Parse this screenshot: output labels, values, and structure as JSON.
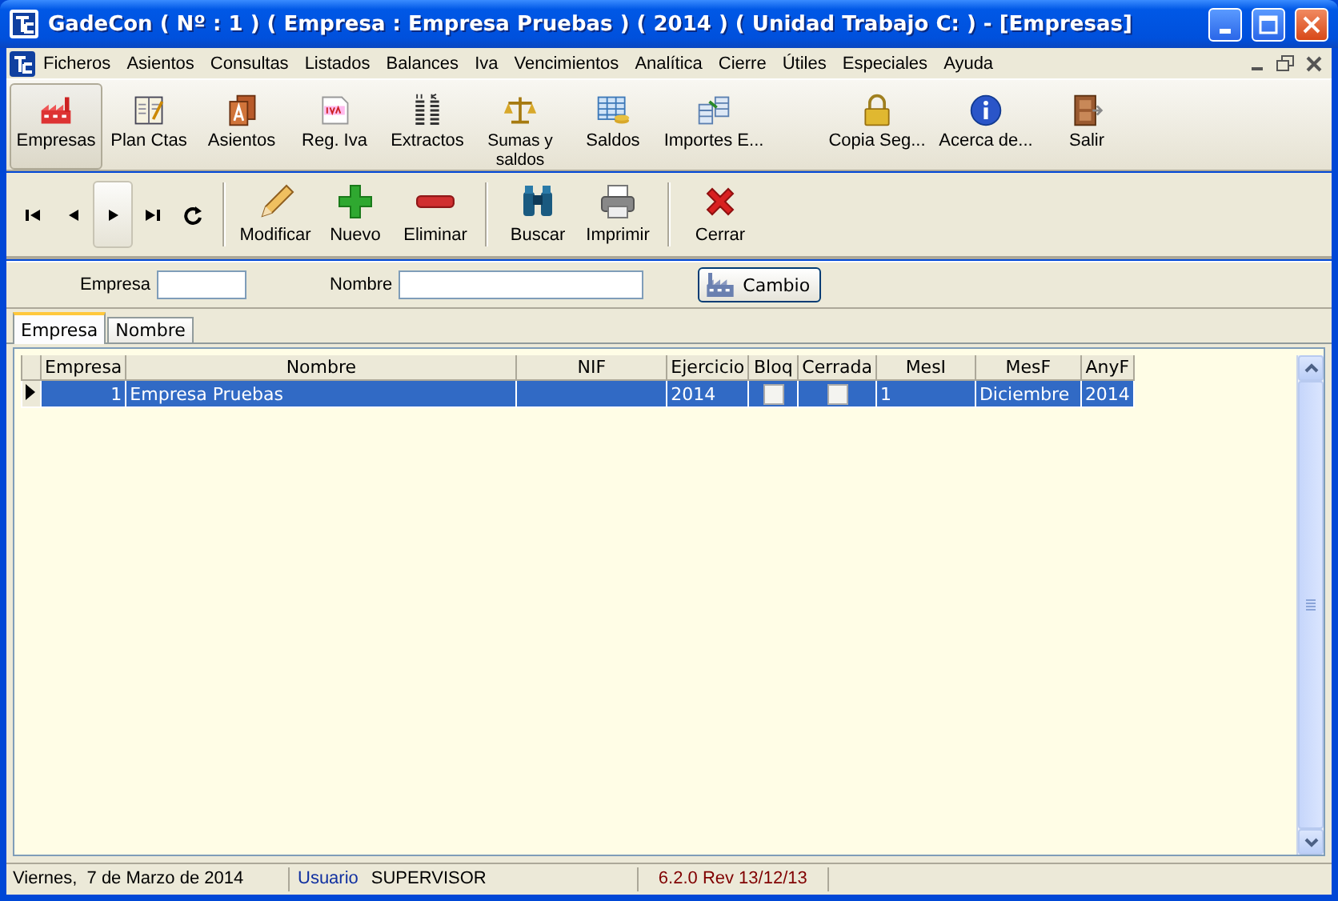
{
  "window": {
    "title": "GadeCon ( Nº : 1 ) ( Empresa : Empresa Pruebas ) ( 2014 ) ( Unidad Trabajo C: ) - [Empresas]"
  },
  "menu": [
    "Ficheros",
    "Asientos",
    "Consultas",
    "Listados",
    "Balances",
    "Iva",
    "Vencimientos",
    "Analítica",
    "Cierre",
    "Útiles",
    "Especiales",
    "Ayuda"
  ],
  "main_toolbar": [
    {
      "label": "Empresas",
      "selected": true
    },
    {
      "label": "Plan Ctas",
      "selected": false
    },
    {
      "label": "Asientos",
      "selected": false
    },
    {
      "label": "Reg. Iva",
      "selected": false
    },
    {
      "label": "Extractos",
      "selected": false
    },
    {
      "label": "Sumas y saldos",
      "selected": false
    },
    {
      "label": "Saldos",
      "selected": false
    },
    {
      "label": "Importes E...",
      "selected": false
    },
    {
      "label": "Copia Seg...",
      "selected": false
    },
    {
      "label": "Acerca de...",
      "selected": false
    },
    {
      "label": "Salir",
      "selected": false
    }
  ],
  "record_toolbar": {
    "navigation": [
      {
        "kind": "first",
        "pressed": false
      },
      {
        "kind": "prev",
        "pressed": false
      },
      {
        "kind": "next",
        "pressed": true
      },
      {
        "kind": "last",
        "pressed": false
      },
      {
        "kind": "refresh",
        "pressed": false
      }
    ],
    "groups": [
      [
        {
          "label": "Modificar"
        },
        {
          "label": "Nuevo"
        },
        {
          "label": "Eliminar"
        }
      ],
      [
        {
          "label": "Buscar"
        },
        {
          "label": "Imprimir"
        }
      ],
      [
        {
          "label": "Cerrar"
        }
      ]
    ]
  },
  "filter": {
    "fields": [
      {
        "label": "Empresa"
      },
      {
        "label": "Nombre"
      }
    ],
    "button": "Cambio"
  },
  "tabs": [
    {
      "label": "Empresa",
      "selected": true
    },
    {
      "label": "Nombre",
      "selected": false
    }
  ],
  "table": {
    "columns": [
      {
        "label": "Empresa",
        "kind": "number"
      },
      {
        "label": "Nombre",
        "kind": "text"
      },
      {
        "label": "NIF",
        "kind": "text"
      },
      {
        "label": "Ejercicio",
        "kind": "text"
      },
      {
        "label": "Bloq",
        "kind": "check"
      },
      {
        "label": "Cerrada",
        "kind": "check"
      },
      {
        "label": "MesI",
        "kind": "text"
      },
      {
        "label": "MesF",
        "kind": "text"
      },
      {
        "label": "AnyF",
        "kind": "text"
      }
    ],
    "rows": [
      {
        "selected": true,
        "cells": [
          {
            "text": "1"
          },
          {
            "text": "Empresa Pruebas"
          },
          {},
          {
            "text": "2014"
          },
          {
            "checked": false
          },
          {
            "checked": false
          },
          {
            "text": "1"
          },
          {
            "text": "Diciembre"
          },
          {
            "text": "2014"
          }
        ]
      }
    ]
  },
  "status_bar": {
    "date": "Viernes,  7 de Marzo de 2014",
    "user_label": "Usuario",
    "user": "SUPERVISOR",
    "version": "6.2.0 Rev 13/12/13"
  }
}
